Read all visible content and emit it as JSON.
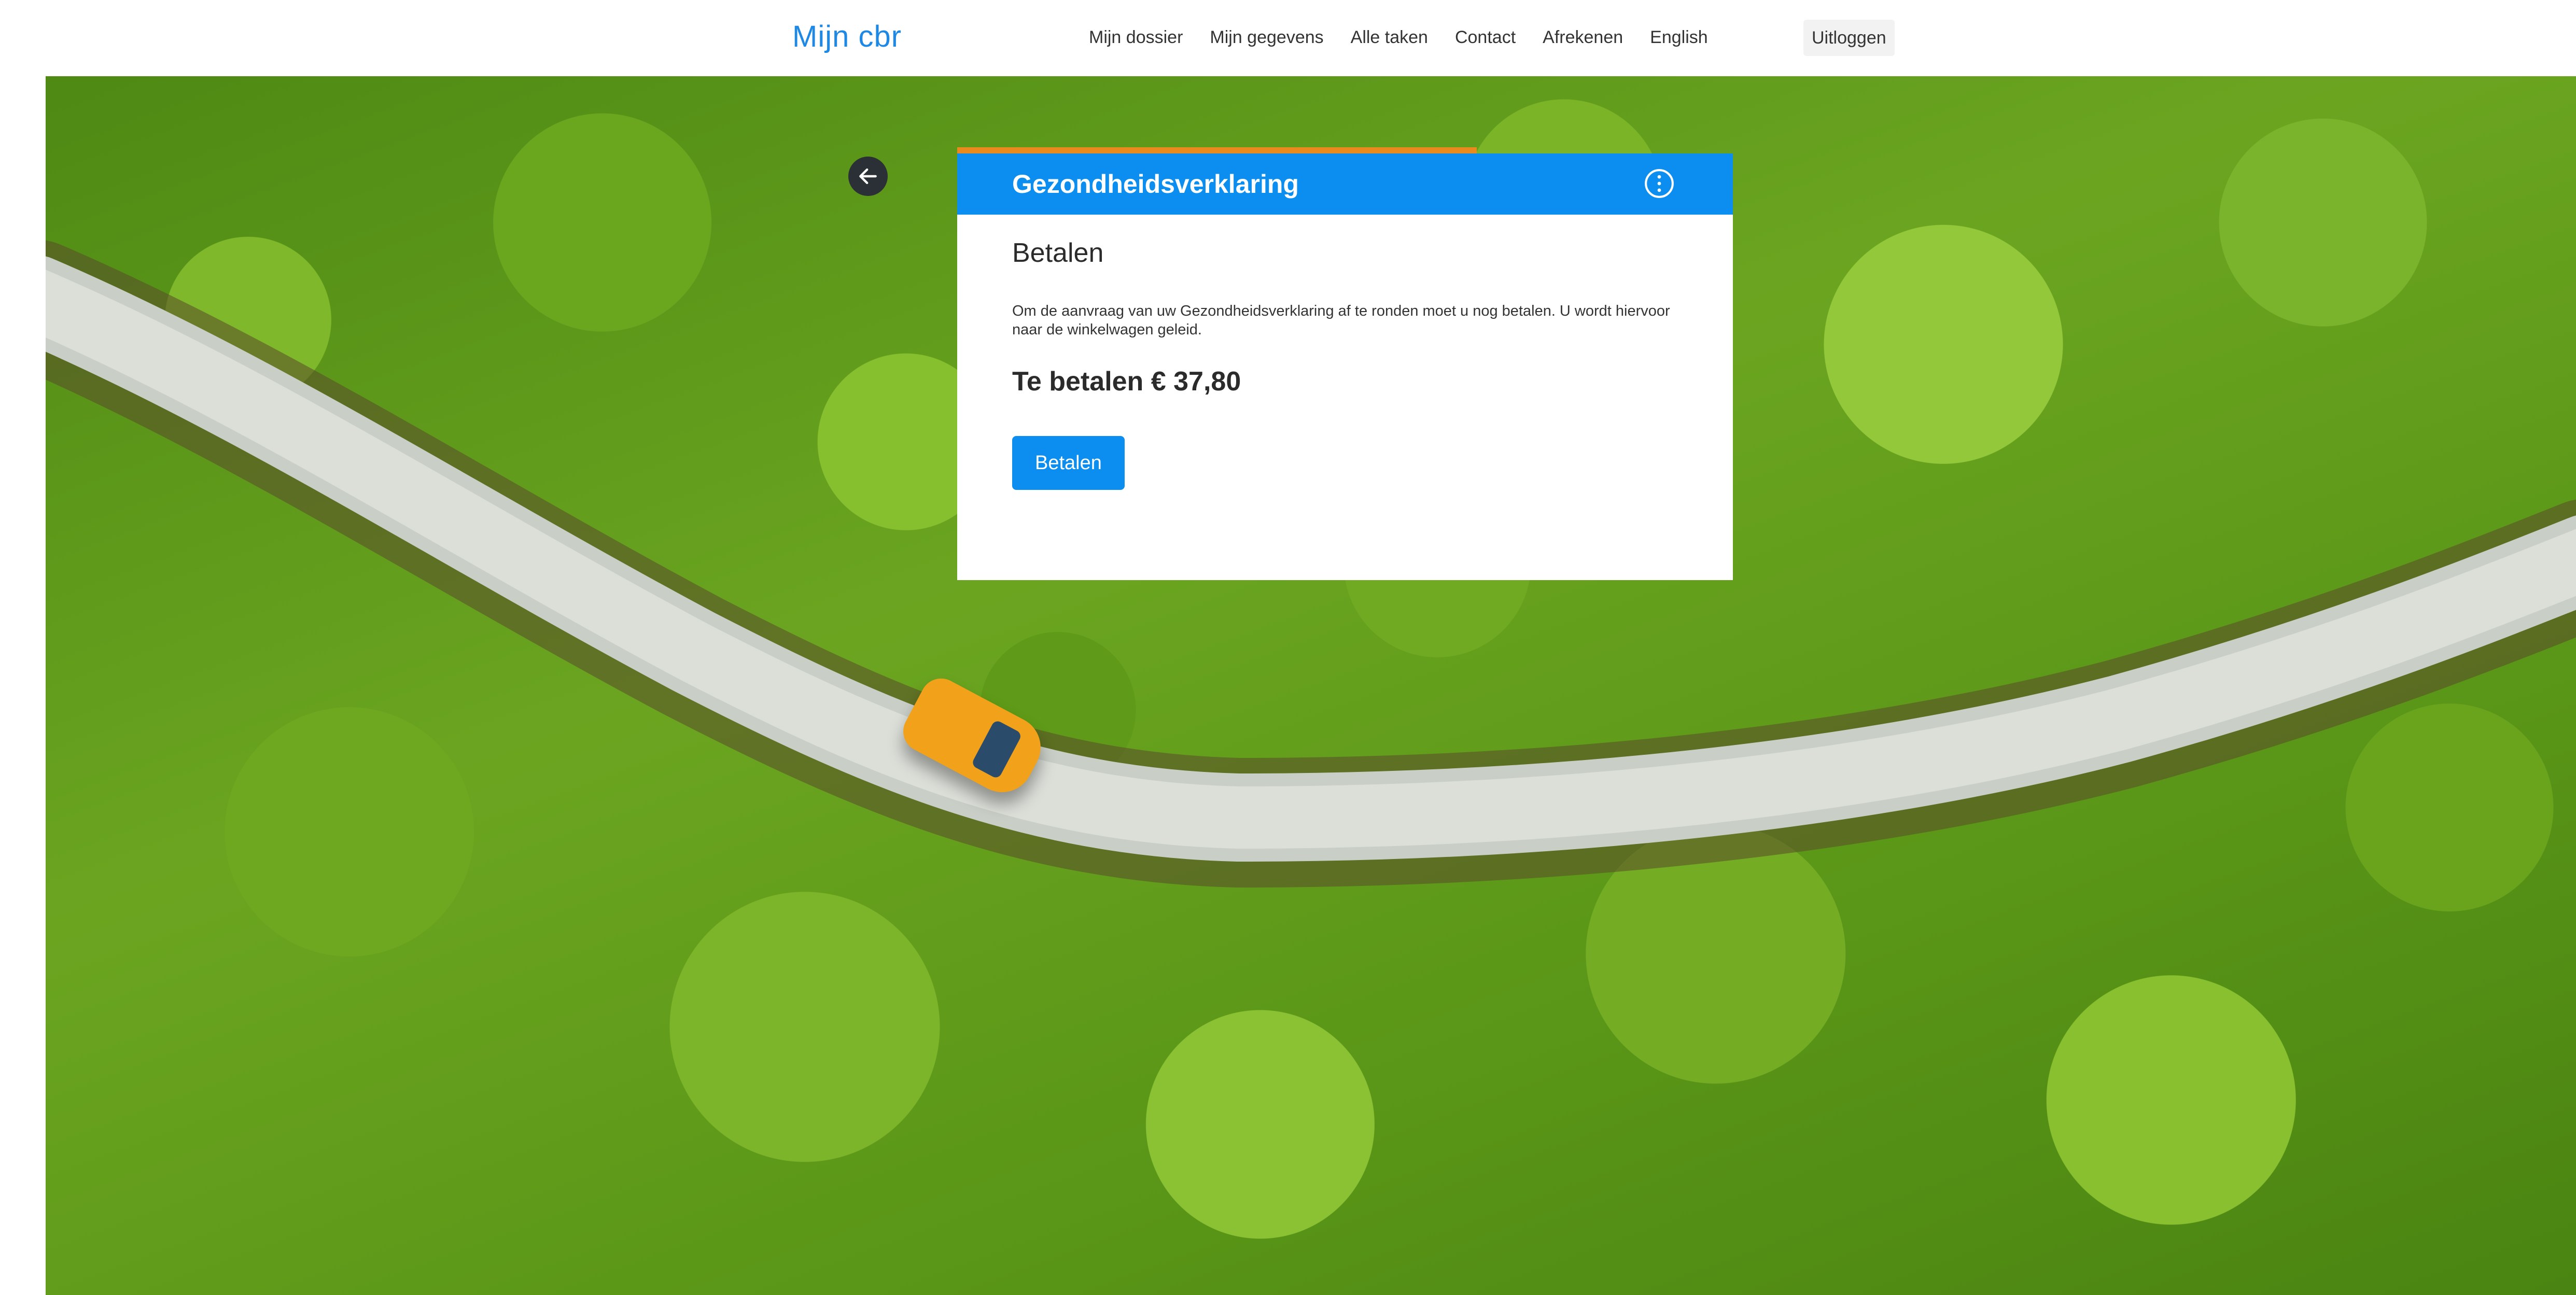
{
  "header": {
    "brand": "Mijn cbr",
    "nav": [
      "Mijn dossier",
      "Mijn gegevens",
      "Alle taken",
      "Contact",
      "Afrekenen",
      "English"
    ],
    "logout_label": "Uitloggen"
  },
  "dialog": {
    "title": "Gezondheidsverklaring",
    "section_title": "Betalen",
    "description": "Om de aanvraag van uw Gezondheidsverklaring af te ronden moet u nog betalen. U wordt hiervoor naar de winkelwagen geleid.",
    "amount_text": "Te betalen € 37,80",
    "pay_button_label": "Betalen",
    "progress_fraction": 0.67
  },
  "icons": {
    "back": "arrow-left-icon",
    "info": "info-icon"
  },
  "colors": {
    "brand": "#1e88e5",
    "header_blue": "#0b8ef0",
    "progress_orange": "#e98a1f",
    "back_button": "#2b2f36"
  }
}
